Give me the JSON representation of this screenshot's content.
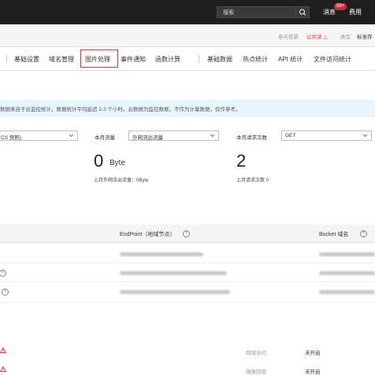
{
  "header": {
    "search_placeholder": "搜索",
    "messages_label": "消息",
    "messages_badge": "99+",
    "fee_label": "费用"
  },
  "subheader": {
    "items": [
      "参与投票",
      "公共读 △",
      "类型",
      "标准存"
    ]
  },
  "tabs": [
    "基础设置",
    "域名管理",
    "图片处理",
    "事件通知",
    "函数计算",
    "基础数据",
    "热点统计",
    "API 统计",
    "文件访问统计"
  ],
  "active_tab": "图片处理",
  "info_banner": "数据来自于云监控统计，数据统计平均延迟 2-3 个小时。云数据为监控数据，不作为计量数据，仅作参考。",
  "stats": {
    "left_select": "CS 快照)",
    "traffic_label": "本月流量",
    "traffic_select": "外网流出流量",
    "traffic_value": "0",
    "traffic_unit": "Byte",
    "traffic_prev": "上月外网流出流量：0Byte",
    "requests_label": "本月请求次数",
    "requests_select": "GET",
    "requests_value": "2",
    "requests_prev": "上月请求次数 0"
  },
  "table": {
    "columns": [
      "EndPoint（地域节点）",
      "Bucket 域名"
    ]
  },
  "bottom": {
    "rows": [
      {
        "label": "跨域访问",
        "status": "未开启"
      },
      {
        "label": "镜像回源",
        "status": "未开启"
      }
    ]
  },
  "colors": {
    "topbar": "#1f1f1f",
    "badge": "#e0263a",
    "active_tab_border": "#e53030",
    "info_bg": "#e9f5fc"
  }
}
